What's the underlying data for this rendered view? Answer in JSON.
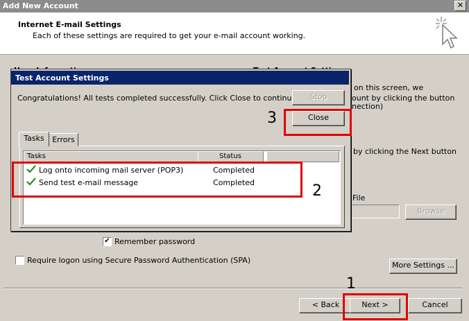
{
  "window": {
    "title": "Add New Account",
    "close_glyph": "✕"
  },
  "header": {
    "title": "Internet E-mail Settings",
    "subtitle": "Each of these settings are required to get your e-mail account working."
  },
  "background": {
    "user_information": "User Information",
    "test_account_settings": "Test Account Settings",
    "right_text_1": "on this screen, we",
    "right_text_2": "ount by clicking the button",
    "right_text_3": "nection)",
    "right_text_4": "by clicking the Next button",
    "file_label": "File",
    "browse_label": "Browse",
    "remember_password": "Remember password",
    "spa_label": "Require logon using Secure Password Authentication (SPA)",
    "more_settings": "More Settings ..."
  },
  "footer": {
    "back": "< Back",
    "next": "Next >",
    "cancel": "Cancel"
  },
  "dialog": {
    "title": "Test Account Settings",
    "message": "Congratulations! All tests completed successfully. Click Close to continue.",
    "stop": "Stop",
    "close": "Close",
    "tabs": [
      "Tasks",
      "Errors"
    ],
    "columns": [
      "Tasks",
      "Status"
    ],
    "rows": [
      {
        "task": "Log onto incoming mail server (POP3)",
        "status": "Completed"
      },
      {
        "task": "Send test e-mail message",
        "status": "Completed"
      }
    ]
  },
  "annotations": {
    "label_1": "1",
    "label_2": "2",
    "label_3": "3",
    "color": "#e00000"
  }
}
